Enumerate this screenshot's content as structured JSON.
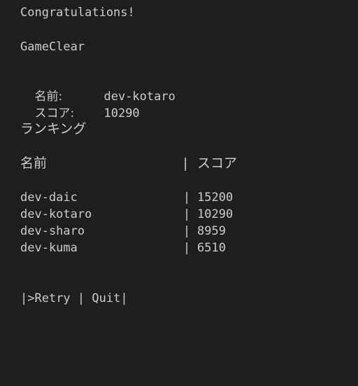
{
  "header": {
    "congrats": "Congratulations!",
    "status": "GameClear"
  },
  "result": {
    "name_label": "名前:",
    "name_value": "dev-kotaro",
    "score_label": "スコア:",
    "score_value": "10290"
  },
  "ranking": {
    "title": "ランキング",
    "columns": {
      "name": "名前",
      "separator": "|",
      "score": "スコア"
    },
    "rows": [
      {
        "name": "dev-daic",
        "separator": "|",
        "score": "15200"
      },
      {
        "name": "dev-kotaro",
        "separator": "|",
        "score": "10290"
      },
      {
        "name": "dev-sharo",
        "separator": "|",
        "score": "8959"
      },
      {
        "name": "dev-kuma",
        "separator": "|",
        "score": "6510"
      }
    ]
  },
  "menu": {
    "open": "|>",
    "retry": "Retry",
    "divider": " | ",
    "quit": "Quit",
    "close": "|"
  }
}
